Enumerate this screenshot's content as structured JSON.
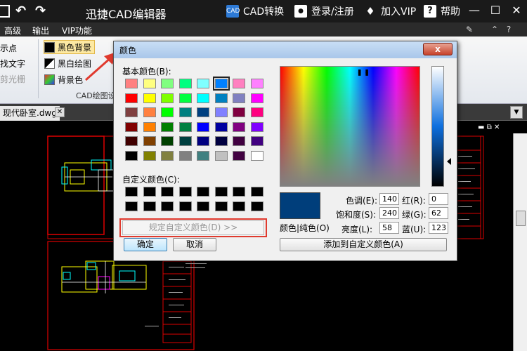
{
  "titlebar": {
    "app_title": "迅捷CAD编辑器",
    "cad_convert": "CAD转换",
    "cad_icon_text": "CAD",
    "login": "登录/注册",
    "vip": "加入VIP",
    "help": "帮助",
    "help_icon_text": "?",
    "undo_icon": "↶",
    "redo_icon": "↷",
    "minimize": "—",
    "maximize": "☐",
    "close": "✕"
  },
  "menubar": {
    "items": [
      "高级",
      "输出",
      "VIP功能"
    ],
    "right_icons": [
      "edit-icon",
      "up-arrow-icon",
      "help-icon"
    ],
    "icon_glyphs": [
      "✎",
      "⌃",
      "?"
    ]
  },
  "ribbon": {
    "left_col": [
      "示点",
      "找文字",
      "剪光栅"
    ],
    "buttons": [
      "黑色背景",
      "黑白绘图",
      "背景色"
    ],
    "group_label": "CAD绘图设"
  },
  "document": {
    "tab_label": "现代卧室.dwg",
    "tab_close": "✕",
    "dropdown": "▼"
  },
  "dialog": {
    "title": "颜色",
    "close": "x",
    "basic_colors_label": "基本颜色(B):",
    "custom_colors_label": "自定义颜色(C):",
    "define_custom_button": "规定自定义颜色(D) >>",
    "ok_button": "确定",
    "cancel_button": "取消",
    "add_custom_button": "添加到自定义颜色(A)",
    "preview_label": "颜色|纯色(O)",
    "hue_label": "色调(E):",
    "sat_label": "饱和度(S):",
    "lum_label": "亮度(L):",
    "red_label": "红(R):",
    "green_label": "绿(G):",
    "blue_label": "蓝(U):",
    "hue": "140",
    "sat": "240",
    "lum": "58",
    "red": "0",
    "green": "62",
    "blue": "123",
    "current_color": "#003e7b",
    "selected_swatch_index": 5,
    "basic_colors": [
      "#ff8080",
      "#ffff80",
      "#80ff80",
      "#00ff80",
      "#80ffff",
      "#0080ff",
      "#ff80c0",
      "#ff80ff",
      "#ff0000",
      "#ffff00",
      "#80ff00",
      "#00ff40",
      "#00ffff",
      "#0080c0",
      "#8080c0",
      "#ff00ff",
      "#804040",
      "#ff8040",
      "#00ff00",
      "#008080",
      "#004080",
      "#8080ff",
      "#800040",
      "#ff0080",
      "#800000",
      "#ff8000",
      "#008000",
      "#008040",
      "#0000ff",
      "#0000a0",
      "#800080",
      "#8000ff",
      "#400000",
      "#804000",
      "#004000",
      "#004040",
      "#000080",
      "#000040",
      "#400040",
      "#400080",
      "#000000",
      "#808000",
      "#808040",
      "#808080",
      "#408080",
      "#c0c0c0",
      "#400040",
      "#ffffff"
    ],
    "custom_colors": [
      "#000000",
      "#000000",
      "#000000",
      "#000000",
      "#000000",
      "#000000",
      "#000000",
      "#000000",
      "#000000",
      "#000000",
      "#000000",
      "#000000",
      "#000000",
      "#000000",
      "#000000",
      "#000000"
    ]
  }
}
